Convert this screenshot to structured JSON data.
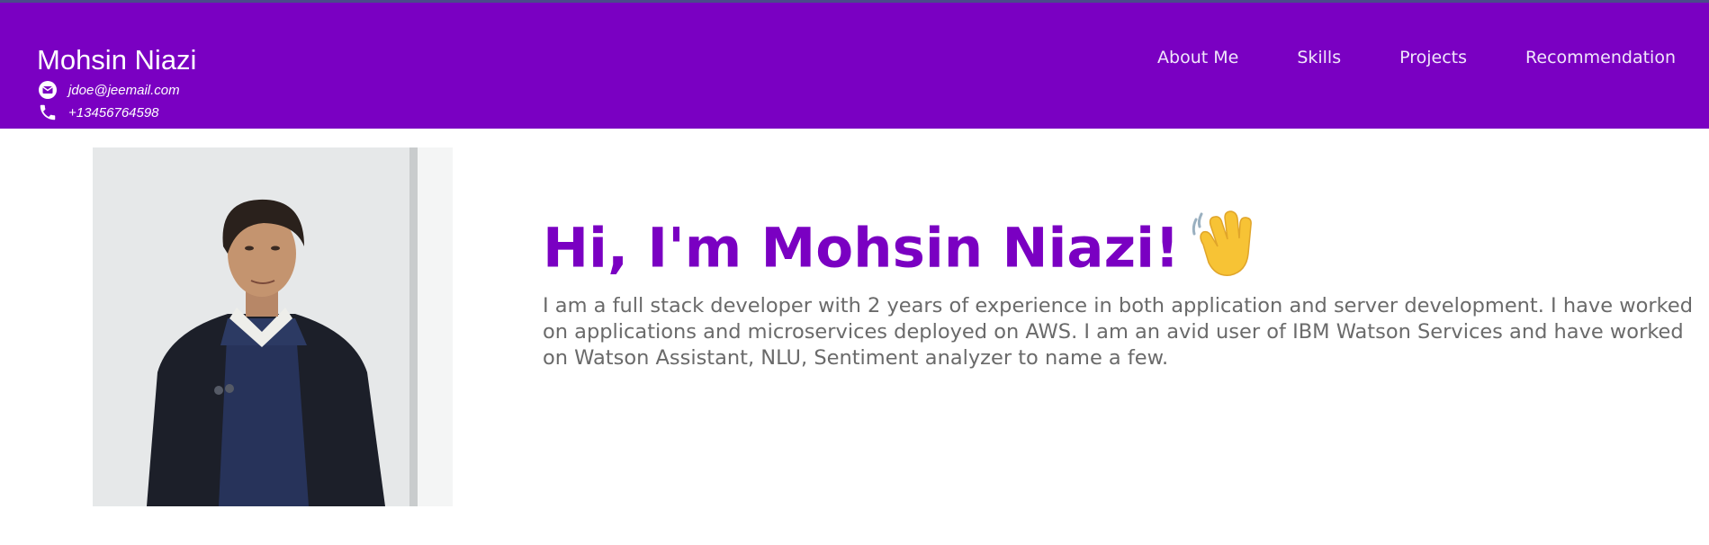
{
  "header": {
    "name": "Mohsin Niazi",
    "email": "jdoe@jeemail.com",
    "phone": "+13456764598",
    "nav": [
      "About Me",
      "Skills",
      "Projects",
      "Recommendation"
    ],
    "background_color": "#7a00c2"
  },
  "hero": {
    "greeting": "Hi, I'm Mohsin Niazi!",
    "emoji": "waving-hand-icon",
    "bio": "I am a full stack developer with 2 years of experience in both application and server development. I have worked on applications and microservices deployed on AWS. I am an avid user of IBM Watson Services and have worked on Watson Assistant, NLU, Sentiment analyzer to name a few.",
    "title_color": "#7a00c2"
  },
  "photo": {
    "subject": "profile-photo"
  }
}
